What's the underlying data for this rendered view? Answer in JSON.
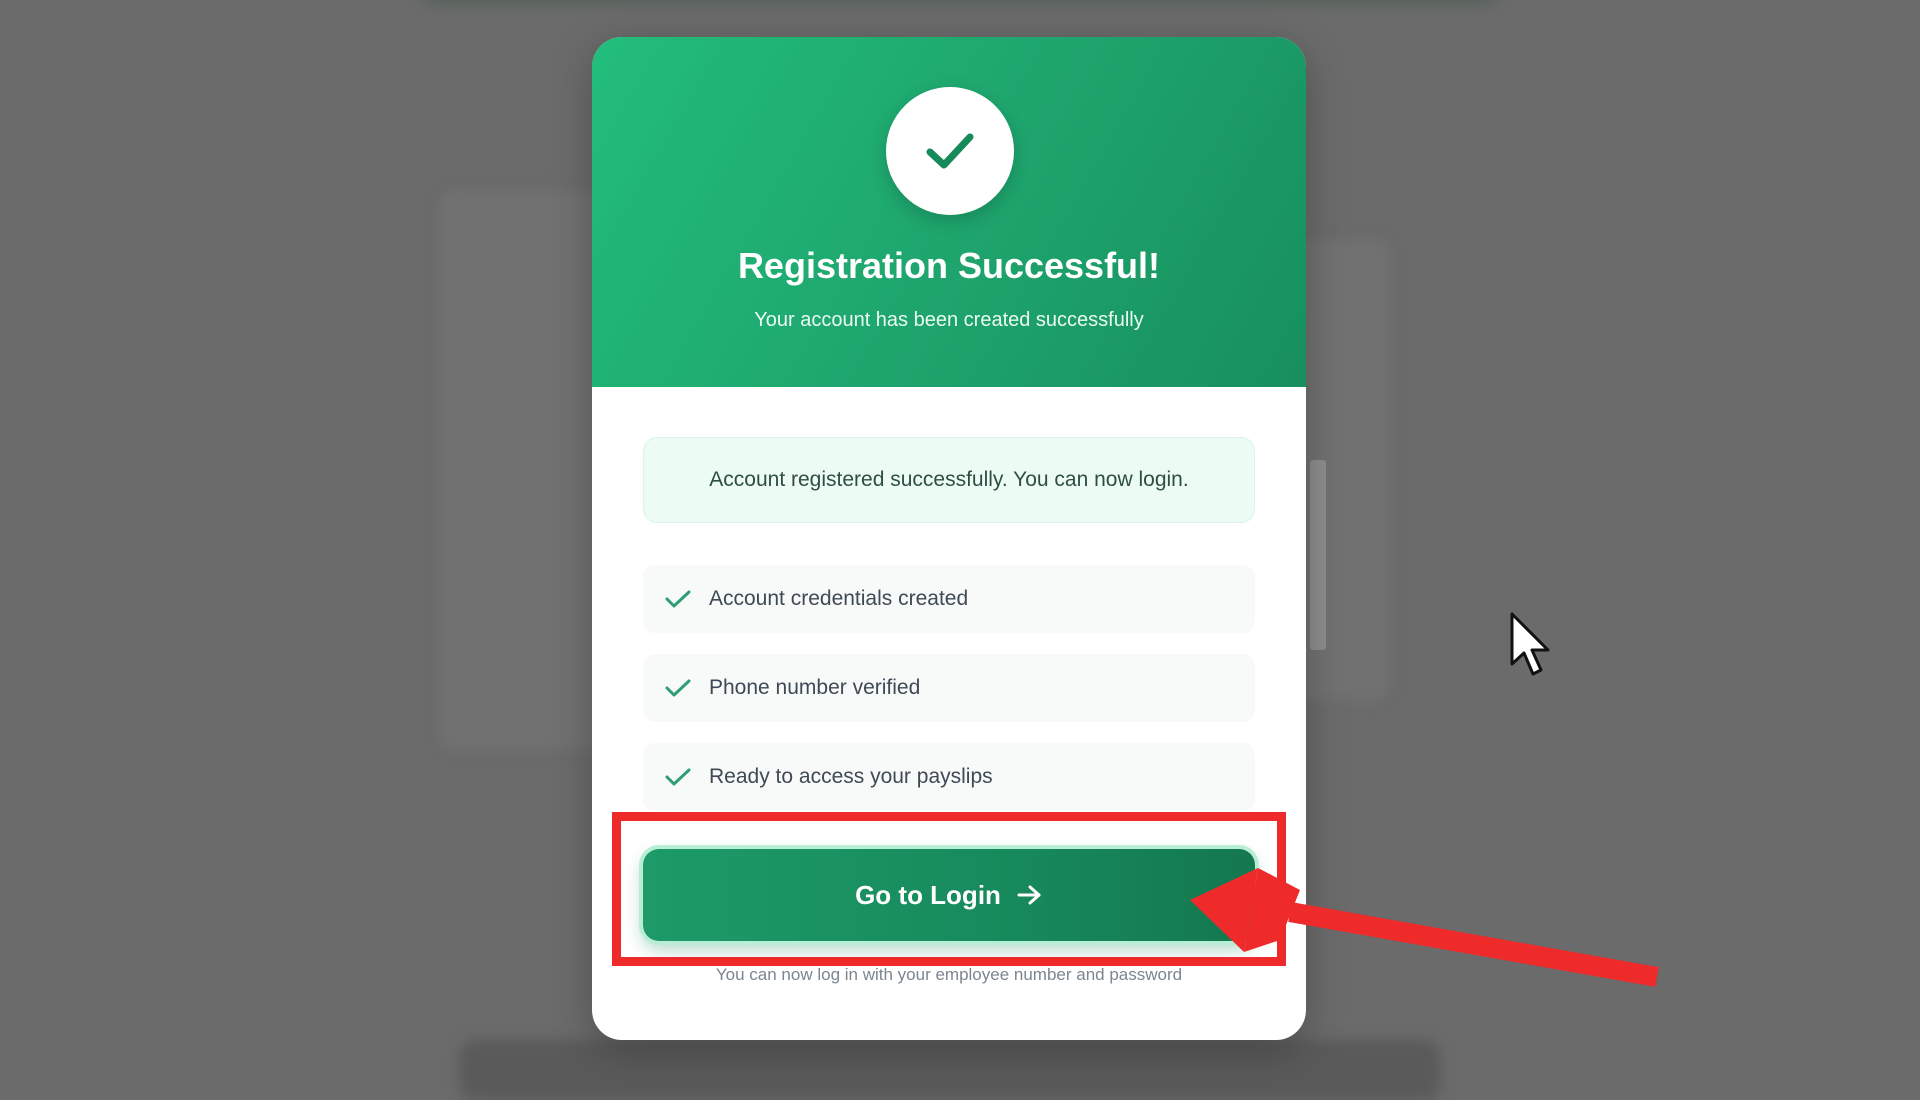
{
  "modal": {
    "title": "Registration Successful!",
    "subtitle": "Your account has been created successfully",
    "success_message": "Account registered successfully. You can now login.",
    "steps": [
      {
        "label": "Account credentials created",
        "icon": "check-icon"
      },
      {
        "label": "Phone number verified",
        "icon": "check-icon"
      },
      {
        "label": "Ready to access your payslips",
        "icon": "check-icon"
      }
    ],
    "login_button_label": "Go to Login",
    "login_button_icon": "arrow-right-icon",
    "footnote": "You can now log in with your employee number and password"
  },
  "colors": {
    "header_green": "#1ea46c",
    "button_green": "#178a5c",
    "annotation_red": "#ef2a2a",
    "success_bg": "#ecfbf3"
  },
  "annotations": {
    "highlight": "red-rectangle",
    "pointer": "red-arrow"
  }
}
